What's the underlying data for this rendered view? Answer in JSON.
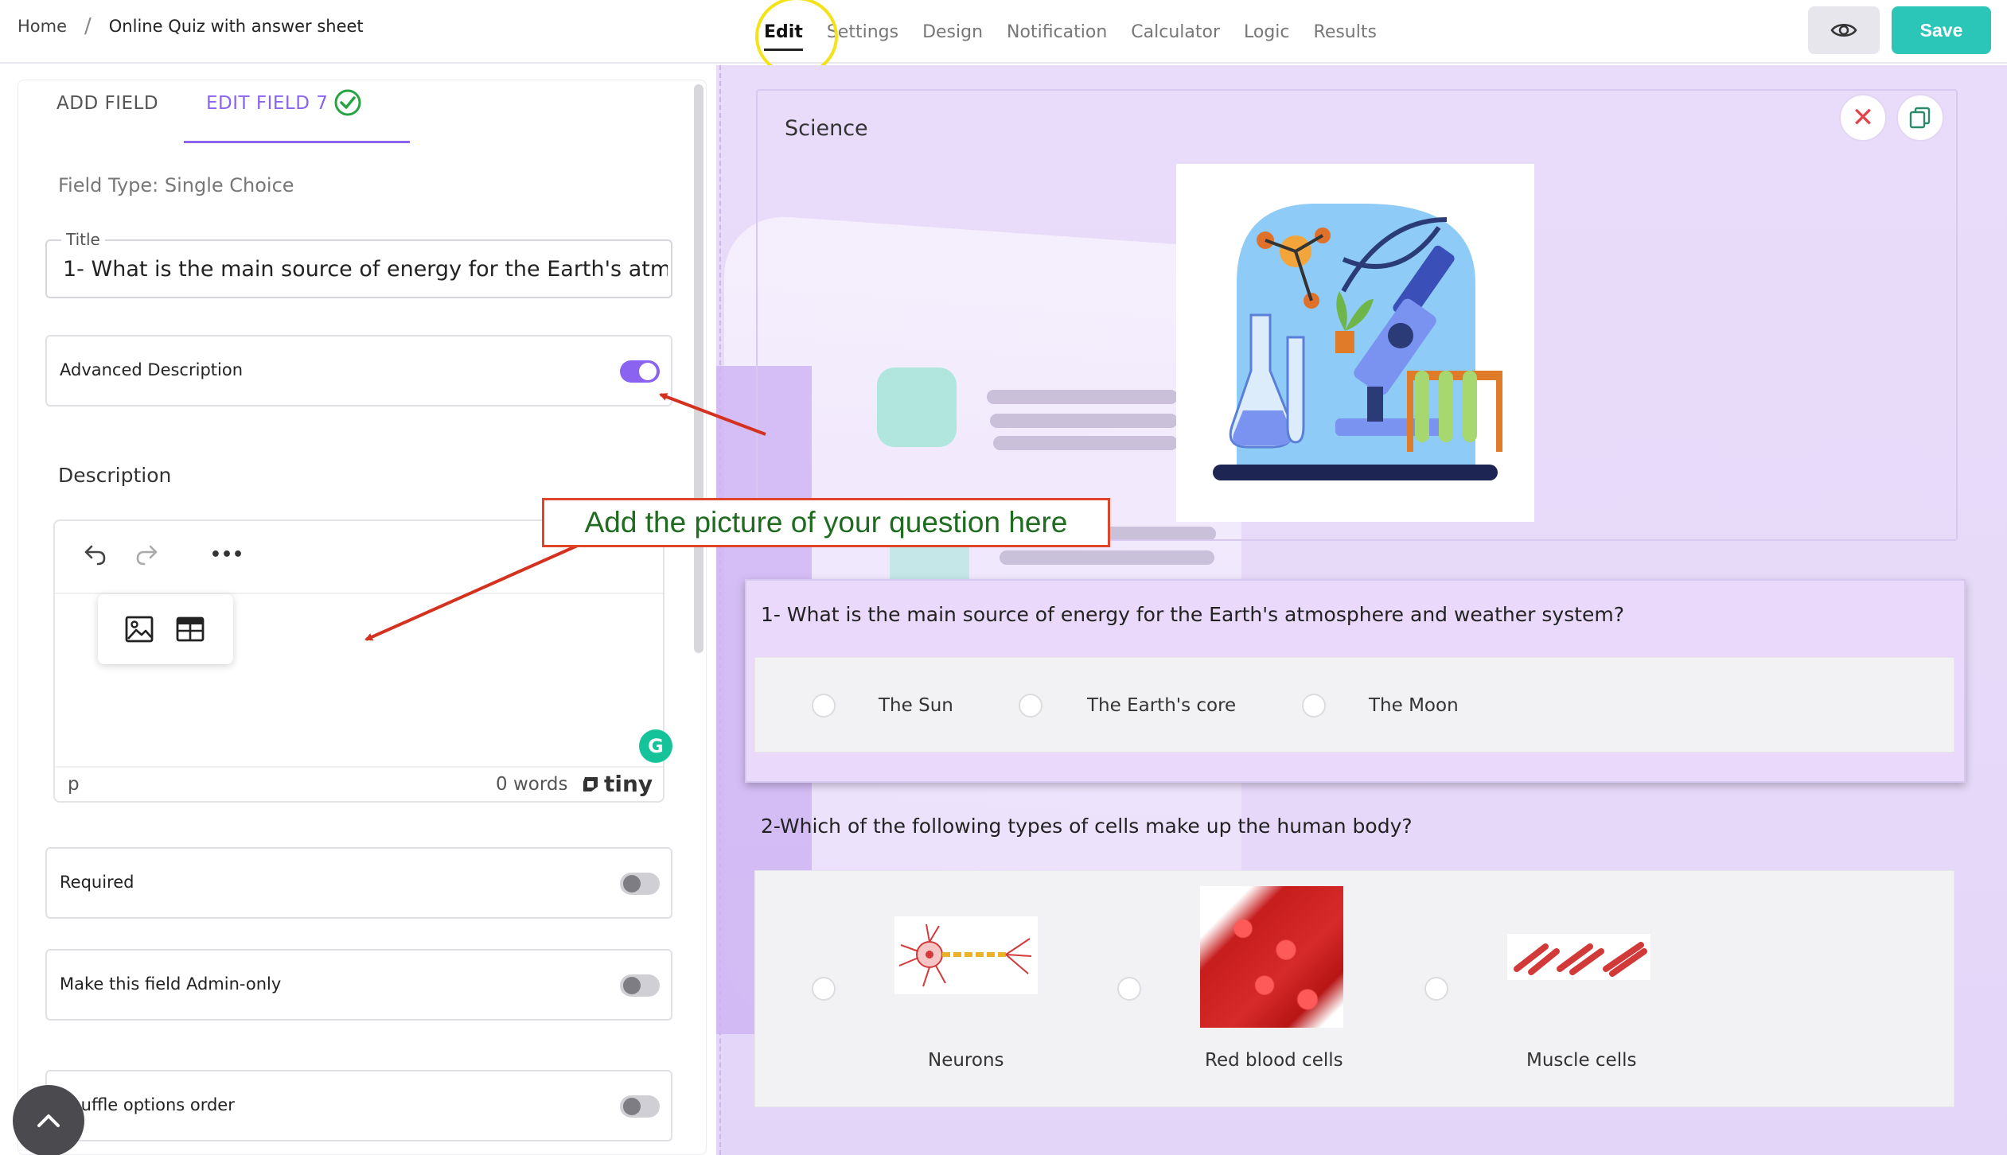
{
  "breadcrumb": {
    "home": "Home",
    "separator": "/",
    "current": "Online Quiz with answer sheet"
  },
  "nav_tabs": [
    {
      "label": "Edit"
    },
    {
      "label": "Settings"
    },
    {
      "label": "Design"
    },
    {
      "label": "Notification"
    },
    {
      "label": "Calculator"
    },
    {
      "label": "Logic"
    },
    {
      "label": "Results"
    }
  ],
  "header": {
    "preview_icon": "eye-icon",
    "save_label": "Save"
  },
  "panel": {
    "tab_add": "ADD FIELD",
    "tab_edit": "EDIT FIELD 7",
    "field_type": "Field Type: Single Choice",
    "title_label": "Title",
    "title_value": "1- What is the main source of energy for the Earth's atmosphere and weather system?",
    "advanced_description": "Advanced Description",
    "advanced_description_on": true,
    "description_heading": "Description",
    "editor": {
      "more_glyph": "•••",
      "path": "p",
      "word_count": "0 words",
      "brand": "tiny"
    },
    "required": "Required",
    "admin_only": "Make this field Admin-only",
    "shuffle": "Shuffle options order"
  },
  "callout": "Add the picture of your question here",
  "preview": {
    "section_title": "Science",
    "q1": {
      "title": "1- What is the main source of energy for the Earth's atmosphere and weather system?",
      "options": [
        "The Sun",
        "The Earth's core",
        "The Moon"
      ]
    },
    "q2": {
      "title": "2-Which of the following types of cells make up the human body?",
      "options": [
        "Neurons",
        "Red blood cells",
        "Muscle cells"
      ]
    }
  },
  "colors": {
    "accent": "#8a63f0",
    "save": "#2cc6b8",
    "preview_bg": "#e9dcfb",
    "annotation": "#e0442a",
    "callout_text": "#1f6b1f"
  }
}
